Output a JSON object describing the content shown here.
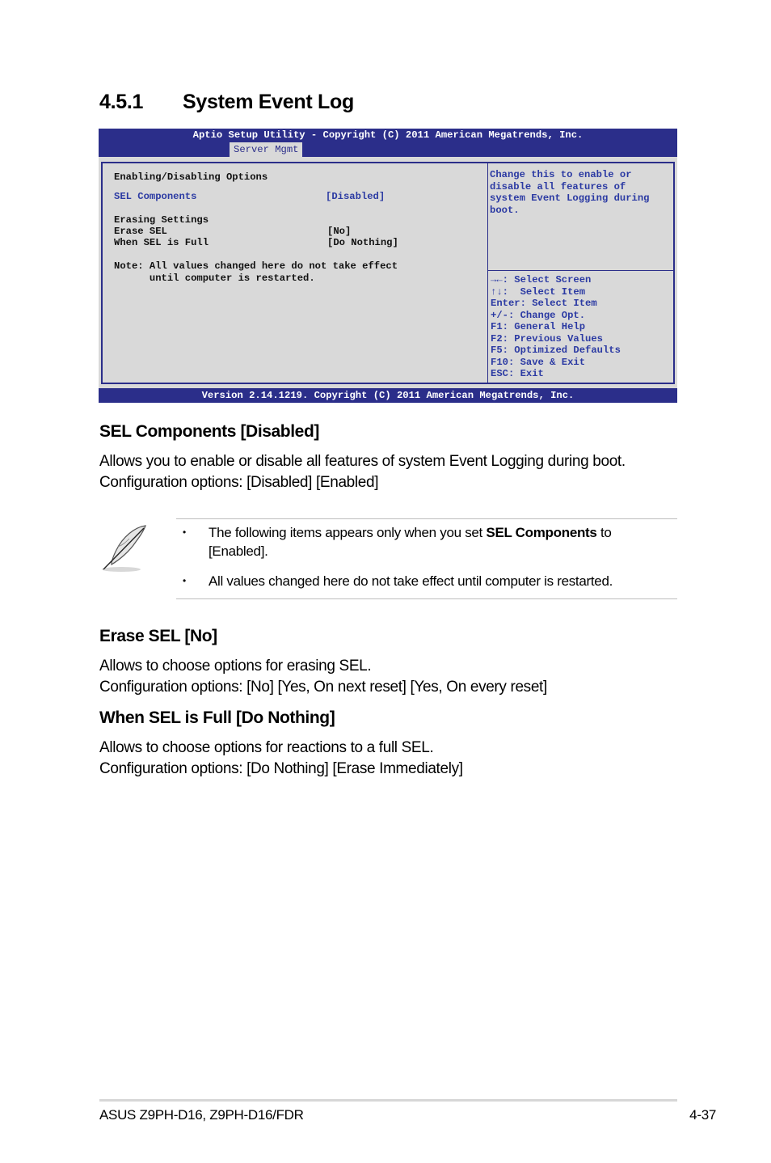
{
  "section": {
    "number": "4.5.1",
    "title": "System Event Log"
  },
  "bios": {
    "header_title": "Aptio Setup Utility - Copyright (C) 2011 American Megatrends, Inc.",
    "active_tab": "Server Mgmt",
    "group_enable": "Enabling/Disabling Options",
    "settings": [
      {
        "label": "SEL Components",
        "value": "[Disabled]"
      },
      {
        "label": "Erase SEL",
        "value": "[No]"
      },
      {
        "label": "When SEL is Full",
        "value": "[Do Nothing]"
      }
    ],
    "group_erase": "Erasing Settings",
    "note_line1": "Note: All values changed here do not take effect",
    "note_line2": "      until computer is restarted.",
    "help_text": "Change this to enable or\ndisable all features of\nsystem Event Logging during\nboot.",
    "keys": [
      "→←: Select Screen",
      "↑↓:  Select Item",
      "Enter: Select Item",
      "+/-: Change Opt.",
      "F1: General Help",
      "F2: Previous Values",
      "F5: Optimized Defaults",
      "F10: Save & Exit",
      "ESC: Exit"
    ],
    "footer": "Version 2.14.1219. Copyright (C) 2011 American Megatrends, Inc.",
    "colors": {
      "bar": "#2b2e8a",
      "panel": "#d9d9d9",
      "highlight_text": "#2b3aa3"
    }
  },
  "sel_components": {
    "heading": "SEL Components [Disabled]",
    "line1": "Allows you to enable or disable all features of system Event Logging during boot.",
    "line2": "Configuration options: [Disabled] [Enabled]"
  },
  "note": {
    "icon": "feather-pen-icon",
    "bullet": "•",
    "item1_pre": "The following items appears only when you set ",
    "item1_bold": "SEL Components",
    "item1_post": " to",
    "item1_line2": "[Enabled].",
    "item2": "All values changed here do not take effect until computer is restarted."
  },
  "erase_sel": {
    "heading": "Erase SEL [No]",
    "line1": "Allows to choose options for erasing SEL.",
    "line2": "Configuration options: [No] [Yes, On next reset] [Yes, On every reset]"
  },
  "when_full": {
    "heading": "When SEL is Full [Do Nothing]",
    "line1": "Allows to choose options for reactions to a full SEL.",
    "line2": "Configuration options: [Do Nothing] [Erase Immediately]"
  },
  "footer": {
    "product": "ASUS Z9PH-D16, Z9PH-D16/FDR",
    "page": "4-37"
  }
}
